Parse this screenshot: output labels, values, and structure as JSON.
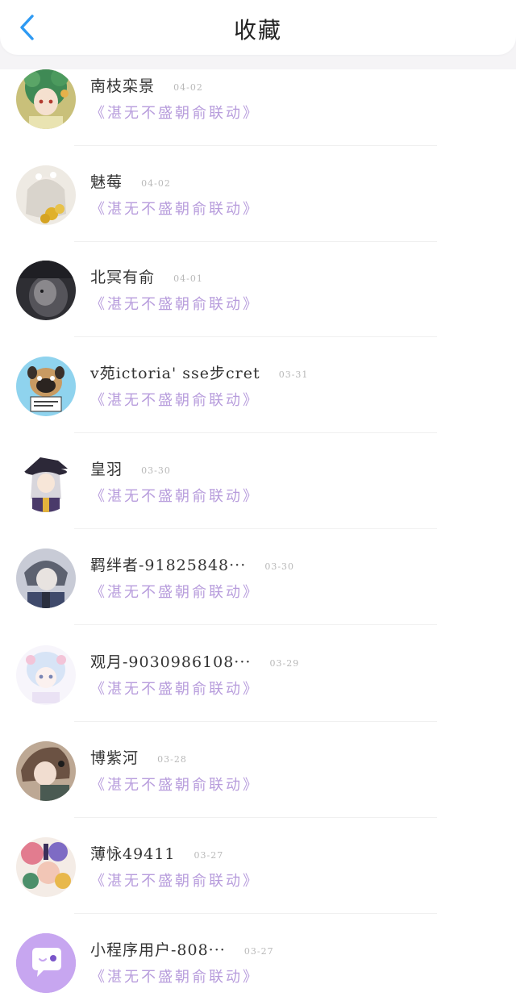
{
  "header": {
    "title": "收藏",
    "back_icon": "chevron-left-icon",
    "back_color": "#2e9af3"
  },
  "items": [
    {
      "name": "南枝栾景",
      "date": "04-02",
      "subtitle": "《湛无不盛朝俞联动》",
      "avatar": "anime-girl-green-hair"
    },
    {
      "name": "魅莓",
      "date": "04-02",
      "subtitle": "《湛无不盛朝俞联动》",
      "avatar": "anime-girl-flowers"
    },
    {
      "name": "北冥有俞",
      "date": "04-01",
      "subtitle": "《湛无不盛朝俞联动》",
      "avatar": "dark-portrait"
    },
    {
      "name": "v苑ictoria' sse步cret",
      "date": "03-31",
      "subtitle": "《湛无不盛朝俞联动》",
      "avatar": "dog-with-sign"
    },
    {
      "name": "皇羽",
      "date": "03-30",
      "subtitle": "《湛无不盛朝俞联动》",
      "avatar": "anime-girl-hat"
    },
    {
      "name": "羁绊者-91825848···",
      "date": "03-30",
      "subtitle": "《湛无不盛朝俞联动》",
      "avatar": "anime-boy-gray"
    },
    {
      "name": "观月-9030986108···",
      "date": "03-29",
      "subtitle": "《湛无不盛朝俞联动》",
      "avatar": "anime-girl-pastel"
    },
    {
      "name": "博紫河",
      "date": "03-28",
      "subtitle": "《湛无不盛朝俞联动》",
      "avatar": "anime-girl-brown"
    },
    {
      "name": "薄怺49411",
      "date": "03-27",
      "subtitle": "《湛无不盛朝俞联动》",
      "avatar": "colorful-illustration"
    },
    {
      "name": "小程序用户-808···",
      "date": "03-27",
      "subtitle": "《湛无不盛朝俞联动》",
      "avatar": "default-chat-avatar"
    }
  ],
  "colors": {
    "subtitle": "#b79cdc",
    "default_avatar": "#c7a6f0"
  }
}
